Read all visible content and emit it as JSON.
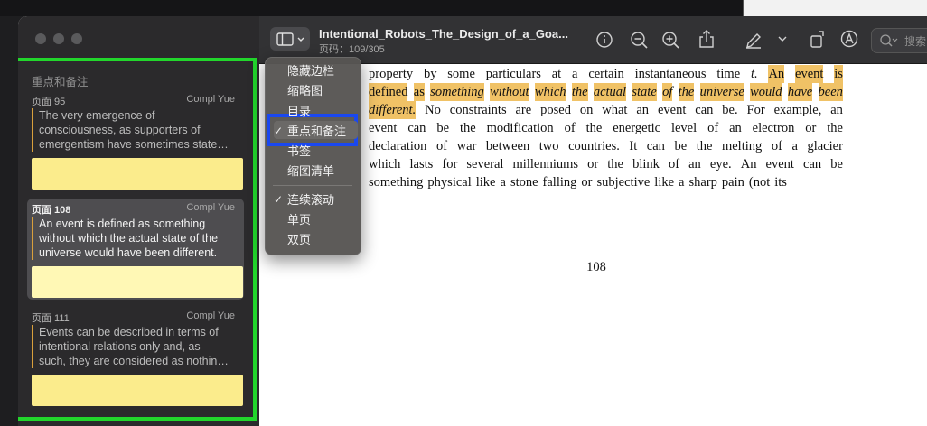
{
  "window": {
    "title": "Intentional_Robots_The_Design_of_a_Goa...",
    "page_indicator": "页码：109/305"
  },
  "toolbar": {
    "icons": [
      "sidebar-icon",
      "chevron-down-icon",
      "info-icon",
      "zoom-out-icon",
      "zoom-in-icon",
      "share-icon",
      "highlight-pen-icon",
      "chevron-down-icon",
      "rotate-icon",
      "markup-icon",
      "search-icon"
    ],
    "search_placeholder": "搜索"
  },
  "sidebar": {
    "panel_title": "重点和备注",
    "highlights": [
      {
        "page": "页面 95",
        "author": "Compl Yue",
        "lines": [
          "The very emergence of",
          "consciousness, as supporters of",
          "emergentism have sometimes state…"
        ]
      },
      {
        "page": "页面 108",
        "author": "Compl Yue",
        "lines": [
          "An event is defined as something",
          "without which the actual state of the",
          "universe would have been different."
        ]
      },
      {
        "page": "页面 111",
        "author": "Compl Yue",
        "lines": [
          "Events can be described in terms of",
          "intentional relations only and, as",
          "such, they are considered as nothin…"
        ]
      }
    ]
  },
  "view_menu": {
    "items": [
      {
        "label": "隐藏边栏",
        "checked": false
      },
      {
        "label": "缩略图",
        "checked": false
      },
      {
        "label": "目录",
        "checked": false
      },
      {
        "label": "重点和备注",
        "checked": true
      },
      {
        "label": "书签",
        "checked": false
      },
      {
        "label": "缩图清单",
        "checked": false
      },
      {
        "label": "连续滚动",
        "checked": true
      },
      {
        "label": "单页",
        "checked": false
      },
      {
        "label": "双页",
        "checked": false
      }
    ],
    "check_mark": "✓"
  },
  "document": {
    "line1": {
      "w": [
        "property",
        "by",
        "some",
        "particulars",
        "at",
        "a",
        "certain",
        "instantaneous",
        "time"
      ],
      "t": "t.",
      "h": [
        "An",
        "event",
        "is"
      ]
    },
    "line2": {
      "h": [
        "defined",
        "as"
      ],
      "i": [
        "something",
        "without",
        "which",
        "the",
        "actual",
        "state",
        "of",
        "the",
        "universe",
        "would",
        "have",
        "been"
      ]
    },
    "line3": {
      "i": "different.",
      "w": [
        "No",
        "constraints",
        "are",
        "posed",
        "on",
        "what",
        "an",
        "event",
        "can",
        "be.",
        "For",
        "example,",
        "an"
      ]
    },
    "line4": [
      "event",
      "can",
      "be",
      "the",
      "modification",
      "of",
      "the",
      "energetic",
      "level",
      "of",
      "an",
      "electron",
      "or",
      "the"
    ],
    "line5": [
      "declaration",
      "of",
      "war",
      "between",
      "two",
      "countries.",
      "It",
      "can",
      "be",
      "the",
      "melting",
      "of",
      "a",
      "glacier"
    ],
    "line6": [
      "which",
      "lasts",
      "for",
      "several",
      "millenniums",
      "or",
      "the",
      "blink",
      "of",
      "an",
      "eye.",
      "An",
      "event",
      "can",
      "be"
    ],
    "line7": [
      "something",
      "physical",
      "like",
      "a",
      "stone",
      "falling",
      "or",
      "subjective",
      "like",
      "a",
      "sharp",
      "pain",
      "(not",
      "its"
    ],
    "page_number": "108"
  },
  "colors": {
    "highlight": "#f0c266",
    "note_fill": "#fbec8c",
    "annotation_green": "#22d62c",
    "annotation_blue": "#1a48f0"
  }
}
